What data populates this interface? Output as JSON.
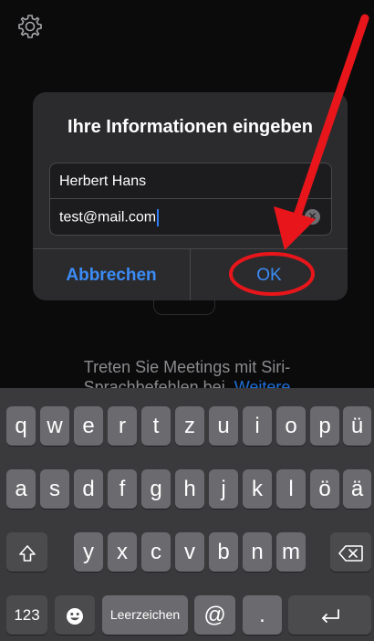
{
  "background": {
    "text_line1": "Treten Sie Meetings mit Siri-",
    "text_line2_prefix": "Sprachbefehlen bei.",
    "text_link": "Weitere"
  },
  "dialog": {
    "title": "Ihre Informationen eingeben",
    "name_value": "Herbert Hans",
    "email_value": "test@mail.com",
    "clear_icon": "x-circle-icon",
    "cancel_label": "Abbrechen",
    "ok_label": "OK"
  },
  "annotation": {
    "arrow_color": "#e8161b",
    "circle_color": "#e8161b"
  },
  "keyboard": {
    "row1": [
      "q",
      "w",
      "e",
      "r",
      "t",
      "z",
      "u",
      "i",
      "o",
      "p",
      "ü"
    ],
    "row2": [
      "a",
      "s",
      "d",
      "f",
      "g",
      "h",
      "j",
      "k",
      "l",
      "ö",
      "ä"
    ],
    "row3": [
      "y",
      "x",
      "c",
      "v",
      "b",
      "n",
      "m"
    ],
    "shift_icon": "shift-arrow-icon",
    "backspace_icon": "backspace-icon",
    "numbers_label": "123",
    "emoji_icon": "emoji-icon",
    "space_label": "Leerzeichen",
    "at_label": "@",
    "dot_label": ".",
    "return_icon": "return-arrow-icon"
  },
  "colors": {
    "accent": "#3b8cf7",
    "key": "#6b6b6f",
    "key_dark": "#4b4b4e"
  }
}
